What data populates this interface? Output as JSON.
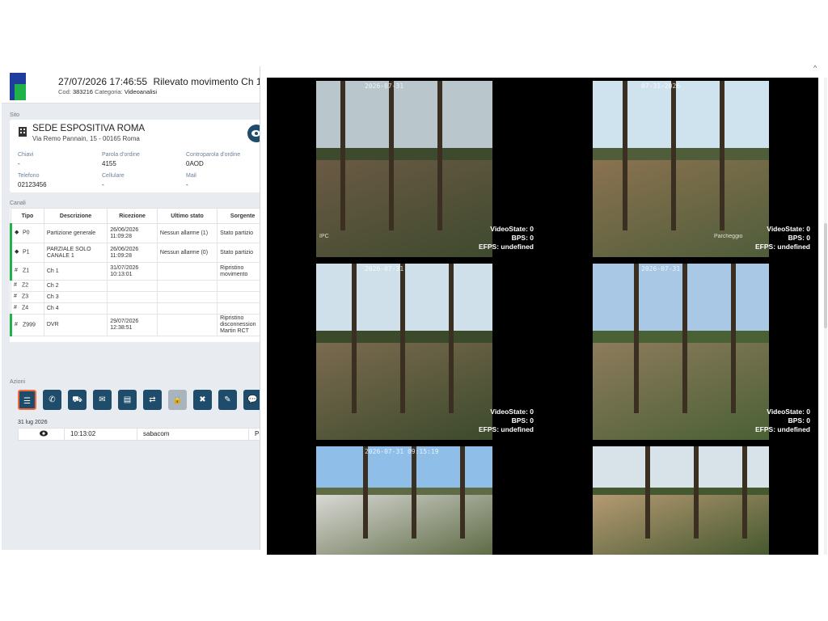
{
  "header": {
    "datetime": "27/07/2026 17:46:55",
    "event": "Rilevato movimento Ch 1",
    "cod_label": "Cod:",
    "cod_value": "383216",
    "category_label": "Categoria:",
    "category_value": "Videoanalisi"
  },
  "site": {
    "section_label": "Sito",
    "name": "SEDE ESPOSITIVA ROMA",
    "address": "Via Remo Pannain, 15 - 00165 Roma",
    "fields": {
      "chiavi": {
        "label": "Chiavi",
        "value": "-"
      },
      "parola": {
        "label": "Parola d'ordine",
        "value": "4155"
      },
      "contro": {
        "label": "Controparola d'ordine",
        "value": "0AOD"
      },
      "telefono": {
        "label": "Telefono",
        "value": "02123456"
      },
      "cellulare": {
        "label": "Cellulare",
        "value": "-"
      },
      "mail": {
        "label": "Mail",
        "value": "-"
      }
    }
  },
  "channels": {
    "section_label": "Canali",
    "headers": [
      "Tipo",
      "Descrizione",
      "Ricezione",
      "Ultimo stato",
      "Sorgente"
    ],
    "rows": [
      {
        "tipo": "P0",
        "icon": "layers-icon",
        "desc": "Partizione generale",
        "ric": "26/06/2026 11:09:28",
        "stato": "Nessun allarme (1)",
        "sorg": "Stato partizio",
        "green": true
      },
      {
        "tipo": "P1",
        "icon": "layers-icon",
        "desc": "PARZIALE SOLO CANALE 1",
        "ric": "26/06/2026 11:09:28",
        "stato": "Nessun allarme (0)",
        "sorg": "Stato partizio",
        "green": true
      },
      {
        "tipo": "Z1",
        "icon": "hash-icon",
        "desc": "Ch 1",
        "ric": "31/07/2026 10:13:01",
        "stato": "",
        "sorg": "Ripristino movimento",
        "green": true
      },
      {
        "tipo": "Z2",
        "icon": "hash-icon",
        "desc": "Ch 2",
        "ric": "",
        "stato": "",
        "sorg": "",
        "green": false
      },
      {
        "tipo": "Z3",
        "icon": "hash-icon",
        "desc": "Ch 3",
        "ric": "",
        "stato": "",
        "sorg": "",
        "green": false
      },
      {
        "tipo": "Z4",
        "icon": "hash-icon",
        "desc": "Ch 4",
        "ric": "",
        "stato": "",
        "sorg": "",
        "green": false
      },
      {
        "tipo": "Z999",
        "icon": "hash-icon",
        "desc": "DVR",
        "ric": "29/07/2026 12:38:51",
        "stato": "",
        "sorg": "Ripristino disconnession Martin RCT",
        "green": true
      }
    ]
  },
  "actions": {
    "section_label": "Azioni",
    "buttons": [
      {
        "name": "list-icon",
        "glyph": "☰"
      },
      {
        "name": "phone-icon",
        "glyph": "✆"
      },
      {
        "name": "car-icon",
        "glyph": "⛟"
      },
      {
        "name": "mail-icon",
        "glyph": "✉"
      },
      {
        "name": "id-card-icon",
        "glyph": "▤"
      },
      {
        "name": "swap-icon",
        "glyph": "⇄"
      },
      {
        "name": "lock-icon",
        "glyph": "🔒"
      },
      {
        "name": "tools-icon",
        "glyph": "✖"
      },
      {
        "name": "edit-icon",
        "glyph": "✎"
      },
      {
        "name": "comment-icon",
        "glyph": "💬"
      }
    ]
  },
  "log": {
    "date": "31 lug 2026",
    "time": "10:13:02",
    "user": "sabacom",
    "extra": "Pr"
  },
  "video": {
    "stats": {
      "state_label": "VideoState: 0",
      "bps_label": "BPS: 0",
      "efps_label": "EFPS: undefined"
    },
    "cams": [
      {
        "timestamp": "2026-07-31",
        "corner": "IPC"
      },
      {
        "timestamp": "07-31-2026",
        "corner": "Parcheggio"
      },
      {
        "timestamp": "2026-07-31",
        "corner": ""
      },
      {
        "timestamp": "2026-07-31",
        "corner": ""
      },
      {
        "timestamp": "2026-07-31 09:15:19",
        "corner": ""
      },
      {
        "timestamp": "",
        "corner": ""
      }
    ]
  }
}
